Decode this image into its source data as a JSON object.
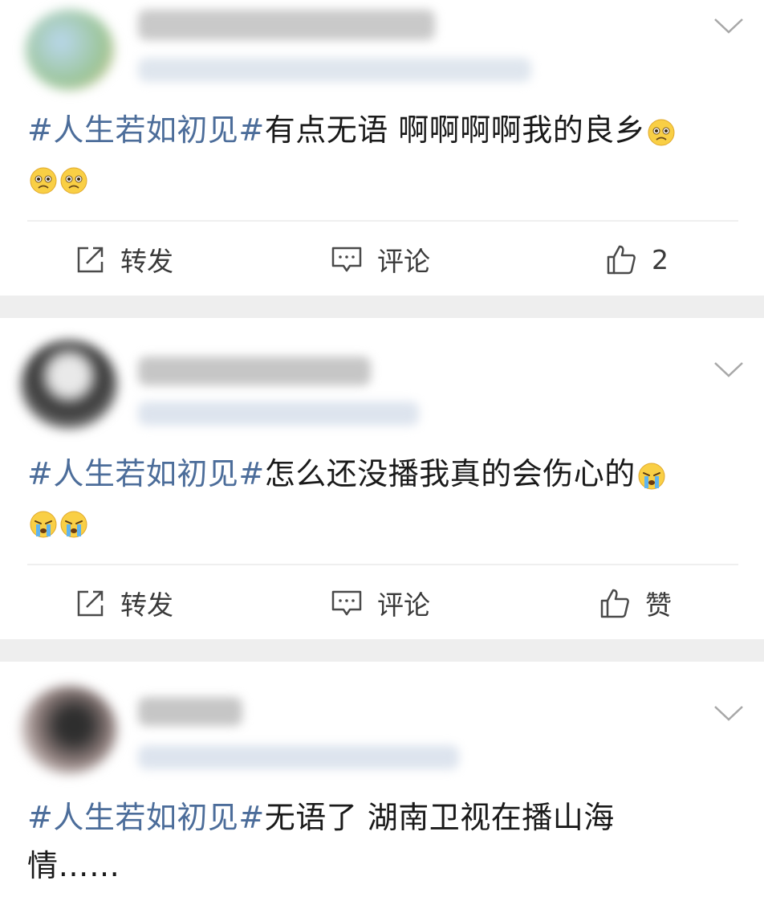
{
  "colors": {
    "topic": "#4c6d9a",
    "text": "#1a1a1a",
    "action_text": "#3a3a3a",
    "separator": "#eeeeee"
  },
  "posts": [
    {
      "topic": "#人生若如初见#",
      "text_line1": "有点无语 啊啊啊啊我的良乡",
      "text_line2": "",
      "emoji": "sad-pleading-face",
      "actions": {
        "repost": "转发",
        "comment": "评论",
        "like": "2"
      }
    },
    {
      "topic": "#人生若如初见#",
      "text_line1": "怎么还没播我真的会伤心的",
      "text_line2": "",
      "emoji": "crying-face",
      "actions": {
        "repost": "转发",
        "comment": "评论",
        "like": "赞"
      }
    },
    {
      "topic": "#人生若如初见#",
      "text_line1": "无语了 湖南卫视在播山海",
      "text_line2": "情……"
    }
  ]
}
